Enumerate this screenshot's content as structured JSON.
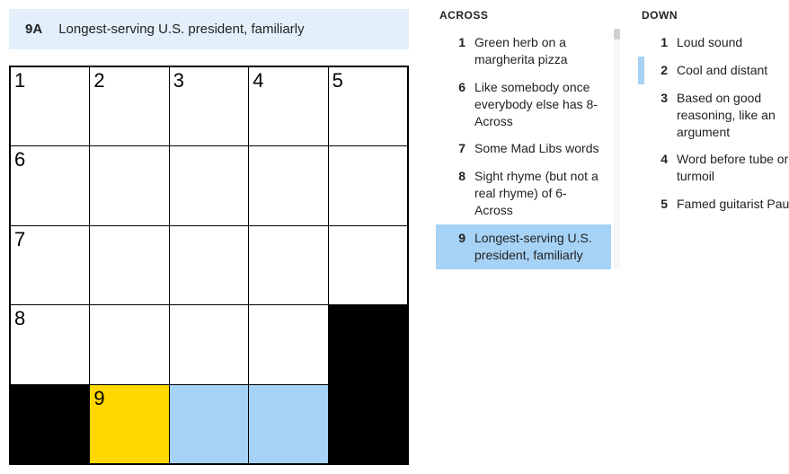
{
  "current": {
    "label": "9A",
    "text": "Longest-serving U.S. president, familiarly"
  },
  "grid": {
    "size": 5,
    "cells": [
      {
        "r": 0,
        "c": 0,
        "num": "1"
      },
      {
        "r": 0,
        "c": 1,
        "num": "2"
      },
      {
        "r": 0,
        "c": 2,
        "num": "3"
      },
      {
        "r": 0,
        "c": 3,
        "num": "4"
      },
      {
        "r": 0,
        "c": 4,
        "num": "5"
      },
      {
        "r": 1,
        "c": 0,
        "num": "6"
      },
      {
        "r": 1,
        "c": 1
      },
      {
        "r": 1,
        "c": 2
      },
      {
        "r": 1,
        "c": 3
      },
      {
        "r": 1,
        "c": 4
      },
      {
        "r": 2,
        "c": 0,
        "num": "7"
      },
      {
        "r": 2,
        "c": 1
      },
      {
        "r": 2,
        "c": 2
      },
      {
        "r": 2,
        "c": 3
      },
      {
        "r": 2,
        "c": 4
      },
      {
        "r": 3,
        "c": 0,
        "num": "8"
      },
      {
        "r": 3,
        "c": 1
      },
      {
        "r": 3,
        "c": 2
      },
      {
        "r": 3,
        "c": 3
      },
      {
        "r": 3,
        "c": 4,
        "black": true
      },
      {
        "r": 4,
        "c": 0,
        "black": true
      },
      {
        "r": 4,
        "c": 1,
        "num": "9",
        "sel": true
      },
      {
        "r": 4,
        "c": 2,
        "hl": true
      },
      {
        "r": 4,
        "c": 3,
        "hl": true
      },
      {
        "r": 4,
        "c": 4,
        "black": true
      }
    ]
  },
  "across": {
    "title": "ACROSS",
    "clues": [
      {
        "n": "1",
        "t": "Green herb on a margherita pizza"
      },
      {
        "n": "6",
        "t": "Like somebody once everybody else has 8-Across"
      },
      {
        "n": "7",
        "t": "Some Mad Libs words"
      },
      {
        "n": "8",
        "t": "Sight rhyme (but not a real rhyme) of 6-Across"
      },
      {
        "n": "9",
        "t": "Longest-serving U.S. president, familiarly",
        "active": true
      }
    ]
  },
  "down": {
    "title": "DOWN",
    "clues": [
      {
        "n": "1",
        "t": "Loud sound"
      },
      {
        "n": "2",
        "t": "Cool and distant",
        "related": true
      },
      {
        "n": "3",
        "t": "Based on good reasoning, like an argument"
      },
      {
        "n": "4",
        "t": "Word before tube or turmoil"
      },
      {
        "n": "5",
        "t": "Famed guitarist Paul"
      }
    ]
  }
}
